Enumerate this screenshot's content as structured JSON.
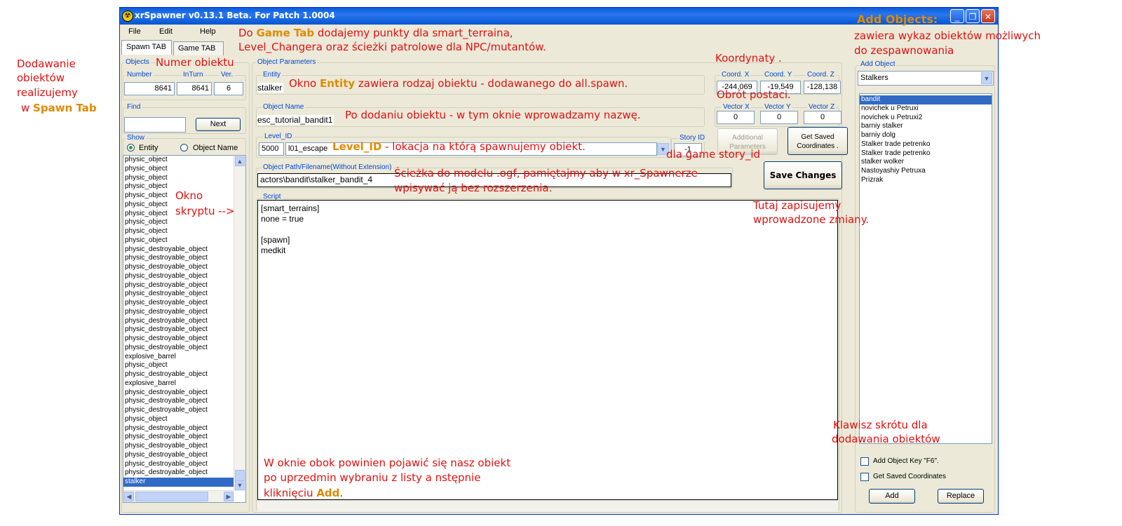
{
  "window": {
    "title": "xrSpawner v0.13.1 Beta. For Patch 1.0004",
    "min_icon": "minimize-icon",
    "max_icon": "maximize-icon",
    "close_icon": "close-icon"
  },
  "menu": {
    "file": "File",
    "edit": "Edit",
    "help": "Help"
  },
  "tabs": {
    "spawn": "Spawn TAB",
    "game": "Game TAB"
  },
  "objects": {
    "group_label": "Objects",
    "number_label": "Number",
    "number_value": "8641",
    "inturn_label": "InTurn",
    "inturn_value": "8641",
    "ver_label": "Ver.",
    "ver_value": "6",
    "find_label": "Find",
    "find_value": "",
    "next_button": "Next",
    "show_label": "Show",
    "radio_entity": "Entity",
    "radio_object_name": "Object Name",
    "list": [
      "physic_object",
      "physic_object",
      "physic_object",
      "physic_object",
      "physic_object",
      "physic_object",
      "physic_object",
      "physic_object",
      "physic_object",
      "physic_object",
      "physic_destroyable_object",
      "physic_destroyable_object",
      "physic_destroyable_object",
      "physic_destroyable_object",
      "physic_destroyable_object",
      "physic_destroyable_object",
      "physic_destroyable_object",
      "physic_destroyable_object",
      "physic_destroyable_object",
      "physic_destroyable_object",
      "physic_destroyable_object",
      "physic_destroyable_object",
      "explosive_barrel",
      "physic_object",
      "physic_destroyable_object",
      "explosive_barrel",
      "physic_destroyable_object",
      "physic_destroyable_object",
      "physic_destroyable_object",
      "physic_object",
      "physic_destroyable_object",
      "physic_destroyable_object",
      "physic_destroyable_object",
      "physic_destroyable_object",
      "physic_destroyable_object",
      "physic_destroyable_object",
      "stalker"
    ]
  },
  "params": {
    "group_label": "Object Parameters",
    "entity_label": "Entity",
    "entity_value": "stalker",
    "coord_x_label": "Coord. X",
    "coord_x_value": "-244,069",
    "coord_y_label": "Coord. Y",
    "coord_y_value": "-19,549",
    "coord_z_label": "Coord. Z",
    "coord_z_value": "-128,138",
    "name_label": "Object Name",
    "name_value": "esc_tutorial_bandit1",
    "vector_x_label": "Vector  X",
    "vector_x_value": "0",
    "vector_y_label": "Vector Y",
    "vector_y_value": "0",
    "vector_z_label": "Vector  Z",
    "vector_z_value": "0",
    "level_label": "Level_ID",
    "level_id_value": "5000",
    "level_name_value": "l01_escape",
    "story_label": "Story ID",
    "story_value": "-1",
    "additional_button": "Additional Parameters",
    "saved_coords_button": "Get Saved Coordinates .",
    "path_label": "Object Path/Filename(Without Extension)",
    "path_value": "actors\\bandit\\stalker_bandit_4",
    "save_button": "Save Changes",
    "script_label": "Script",
    "script_lines": [
      "[smart_terrains]",
      "none = true",
      "",
      "[spawn]",
      "medkit"
    ]
  },
  "add_object": {
    "group_label": "Add Object",
    "category_value": "Stalkers",
    "list": [
      "bandit",
      "novichek u Petruxi",
      "novichek u Petruxi2",
      "barniy stalker",
      "barniy dolg",
      "Stalker trade petrenko",
      "Stalker trade petrenko",
      "stalker wolker",
      "Nastoyashiy Petruxa",
      "Prizrak"
    ],
    "check_f6": "Add Object Key \"F6\".",
    "check_saved": "Get Saved Coordinates",
    "add_button": "Add",
    "replace_button": "Replace"
  },
  "annotations": {
    "spawn_tab_1": "Dodawanie",
    "spawn_tab_2": "obiektów",
    "spawn_tab_3": "realizujemy",
    "spawn_tab_4a": "w ",
    "spawn_tab_4b": "Spawn Tab",
    "numer": "Numer obiektu",
    "game_tab_a": "Do ",
    "game_tab_b": "Game Tab",
    "game_tab_c": " dodajemy punkty dla smart_terraina,",
    "game_tab_2": "Level_Changera oraz ścieżki patrolowe dla NPC/mutantów.",
    "koordynaty": "Koordynaty .",
    "add_objects_title": "Add Objects:",
    "add_objects_2": "zawiera wykaz obiektów możliwych",
    "add_objects_3": "do zespawnowania",
    "entity_a": "Okno ",
    "entity_b": "Entity",
    "entity_c": " zawiera rodzaj obiektu - dodawanego do all.spawn.",
    "obrot": "Obrót postaci.",
    "name": "Po dodaniu obiektu - w tym oknie wprowadzamy nazwę.",
    "level_b": "Level_ID",
    "level_c": " - lokacja na którą spawnujemy obiekt.",
    "story": "dla game story_id",
    "path_1": "Ścieżka do modelu .ogf, pamiętajmy aby w xr_Spawnerze",
    "path_2": "wpisywać ją bez rozszerzenia.",
    "okno_1": "Okno",
    "okno_2": "skryptu  -->",
    "tutaj_1": "Tutaj zapisujemy",
    "tutaj_2": "wprowadzone zmiany.",
    "klawisz_1": "Klawisz skrótu dla",
    "klawisz_2": "dodawania obiektów",
    "bottom_1": "W oknie obok powinien pojawić się nasz obiekt",
    "bottom_2": "po uprzedmin wybraniu z listy a nstępnie",
    "bottom_3a": "kliknięciu ",
    "bottom_3b": "Add",
    "bottom_3c": "."
  }
}
